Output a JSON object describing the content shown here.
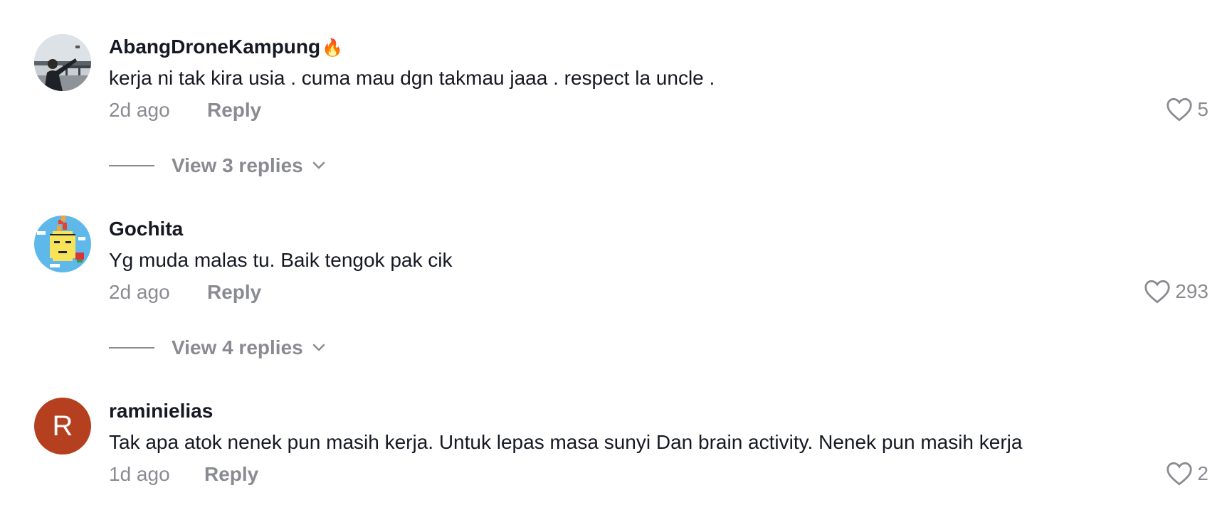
{
  "comments": [
    {
      "username": "AbangDroneKampung",
      "username_emoji": "🔥",
      "text": "kerja ni tak kira usia . cuma mau dgn takmau jaaa . respect la uncle .",
      "time": "2d ago",
      "reply_label": "Reply",
      "likes": "5",
      "view_replies": "View 3 replies",
      "avatar": "photo-avatar"
    },
    {
      "username": "Gochita",
      "text": "Yg muda malas tu. Baik tengok pak cik",
      "time": "2d ago",
      "reply_label": "Reply",
      "likes": "293",
      "view_replies": "View 4 replies",
      "avatar": "pixel-art-avatar"
    },
    {
      "username": "raminielias",
      "text": "Tak apa atok nenek pun masih kerja. Untuk lepas masa sunyi Dan brain activity. Nenek pun masih kerja",
      "time": "1d ago",
      "reply_label": "Reply",
      "likes": "2",
      "avatar_letter": "R",
      "avatar_color": "#b5401f"
    }
  ],
  "colors": {
    "text_primary": "#161823",
    "text_secondary": "#8a8b91"
  }
}
